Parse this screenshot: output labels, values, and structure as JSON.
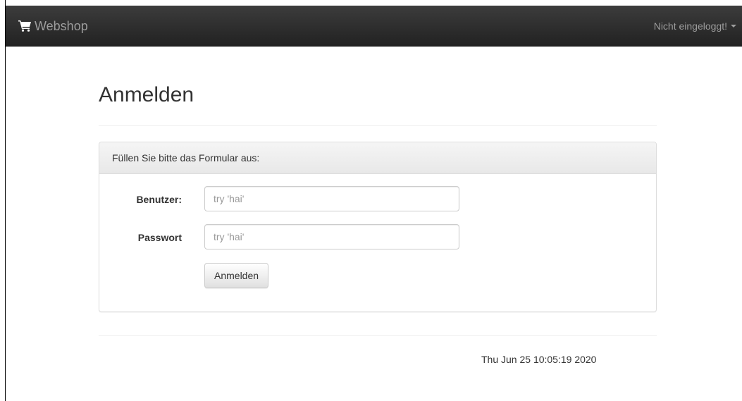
{
  "navbar": {
    "brand_icon": "shopping-cart-icon",
    "brand_label": "Webshop",
    "user_menu_label": "Nicht eingeloggt!",
    "user_menu_icon": "caret-down-icon",
    "background_color": "#222222",
    "text_color": "#9d9d9d"
  },
  "page": {
    "title": "Anmelden"
  },
  "login_panel": {
    "heading": "Füllen Sie bitte das Formular aus:",
    "username": {
      "label": "Benutzer:",
      "value": "",
      "placeholder": "try 'hai'"
    },
    "password": {
      "label": "Passwort",
      "value": "",
      "placeholder": "try 'hai'"
    },
    "submit_label": "Anmelden"
  },
  "footer": {
    "timestamp": "Thu Jun 25 10:05:19 2020"
  }
}
